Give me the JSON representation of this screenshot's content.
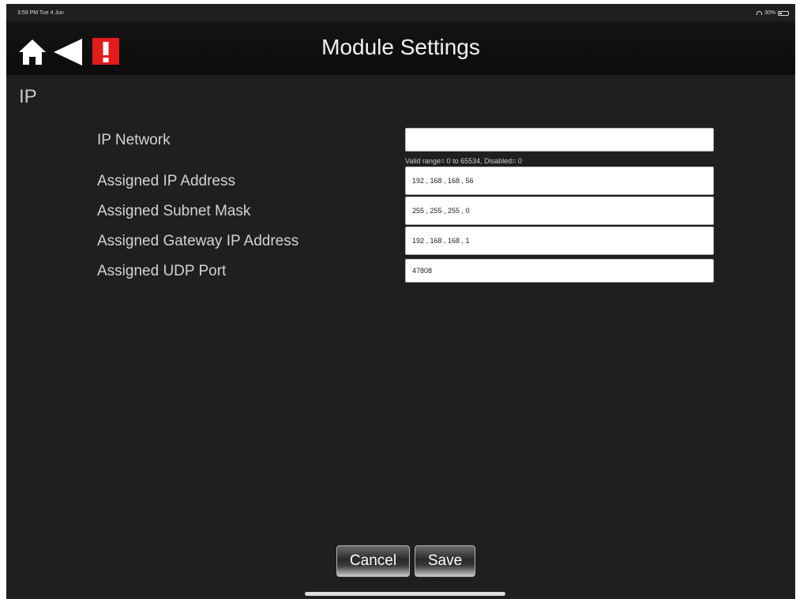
{
  "status_bar": {
    "time_date": "3:59 PM  Tue 4 Jun",
    "battery": "30%",
    "battery_level": 0.3
  },
  "header": {
    "title": "Module Settings"
  },
  "icons": {
    "home": "home-icon",
    "back": "back-arrow-icon",
    "alert": "alert-icon"
  },
  "colors": {
    "alert_red": "#e21b1b",
    "background": "#1f1f1f",
    "header": "#0f0f0f"
  },
  "section": {
    "title": "IP"
  },
  "fields": {
    "ip_network": {
      "label": "IP Network",
      "value": "",
      "hint": "Valid range= 0 to 65534, Disabled= 0"
    },
    "assigned_ip": {
      "label": "Assigned IP Address",
      "value": "192 , 168 , 168 , 56"
    },
    "subnet_mask": {
      "label": "Assigned Subnet Mask",
      "value": "255 , 255 , 255 , 0"
    },
    "gateway_ip": {
      "label": "Assigned Gateway IP Address",
      "value": "192 , 168 , 168 , 1"
    },
    "udp_port": {
      "label": "Assigned UDP Port",
      "value": "47808"
    }
  },
  "buttons": {
    "cancel": "Cancel",
    "save": "Save"
  }
}
